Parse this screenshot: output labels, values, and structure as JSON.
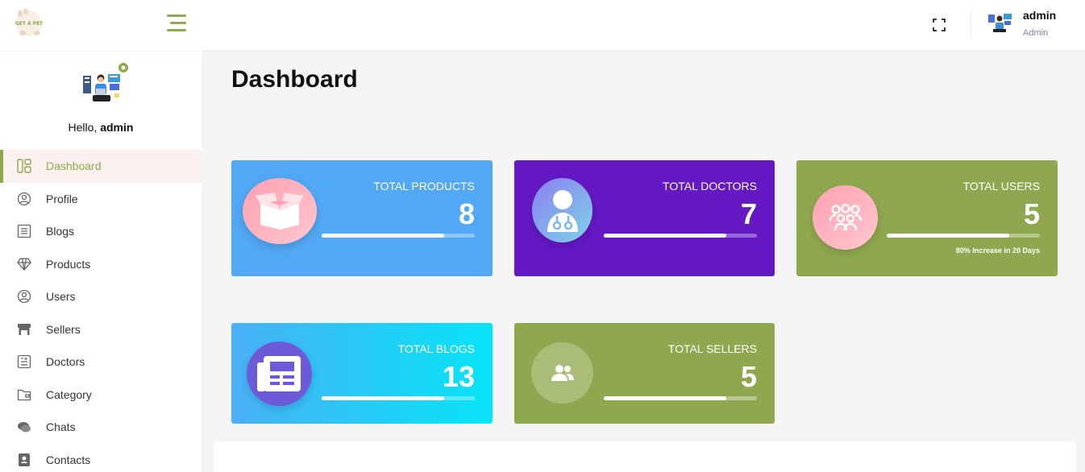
{
  "app": {
    "logo_text": "GET A PET"
  },
  "header": {
    "user_name": "admin",
    "user_role": "Admin"
  },
  "sidebar": {
    "greeting_prefix": "Hello,",
    "greeting_name": "admin",
    "items": [
      {
        "label": "Dashboard",
        "icon": "dashboard-icon",
        "active": true
      },
      {
        "label": "Profile",
        "icon": "profile-icon"
      },
      {
        "label": "Blogs",
        "icon": "blogs-icon"
      },
      {
        "label": "Products",
        "icon": "diamond-icon"
      },
      {
        "label": "Users",
        "icon": "users-icon"
      },
      {
        "label": "Sellers",
        "icon": "store-icon"
      },
      {
        "label": "Doctors",
        "icon": "doctors-icon"
      },
      {
        "label": "Category",
        "icon": "folder-icon"
      },
      {
        "label": "Chats",
        "icon": "chat-icon"
      },
      {
        "label": "Contacts",
        "icon": "contacts-icon"
      }
    ]
  },
  "main": {
    "title": "Dashboard",
    "cards": [
      {
        "title": "TOTAL PRODUCTS",
        "value": "8",
        "progress": 0.8,
        "icon": "box-icon",
        "color": "#52a8f5"
      },
      {
        "title": "TOTAL DOCTORS",
        "value": "7",
        "progress": 0.8,
        "icon": "doctor-icon",
        "color": "#6419c4"
      },
      {
        "title": "TOTAL USERS",
        "value": "5",
        "progress": 0.8,
        "icon": "group-icon",
        "color": "#8fa84f",
        "note": "80% Increase in 20 Days"
      },
      {
        "title": "TOTAL BLOGS",
        "value": "13",
        "progress": 0.8,
        "icon": "newspaper-icon",
        "color": "#2bd0f8"
      },
      {
        "title": "TOTAL SELLERS",
        "value": "5",
        "progress": 0.8,
        "icon": "sellers-icon",
        "color": "#8fa84f"
      }
    ]
  },
  "colors": {
    "accent": "#8fa84f",
    "active_bg": "#fbf1ee"
  }
}
